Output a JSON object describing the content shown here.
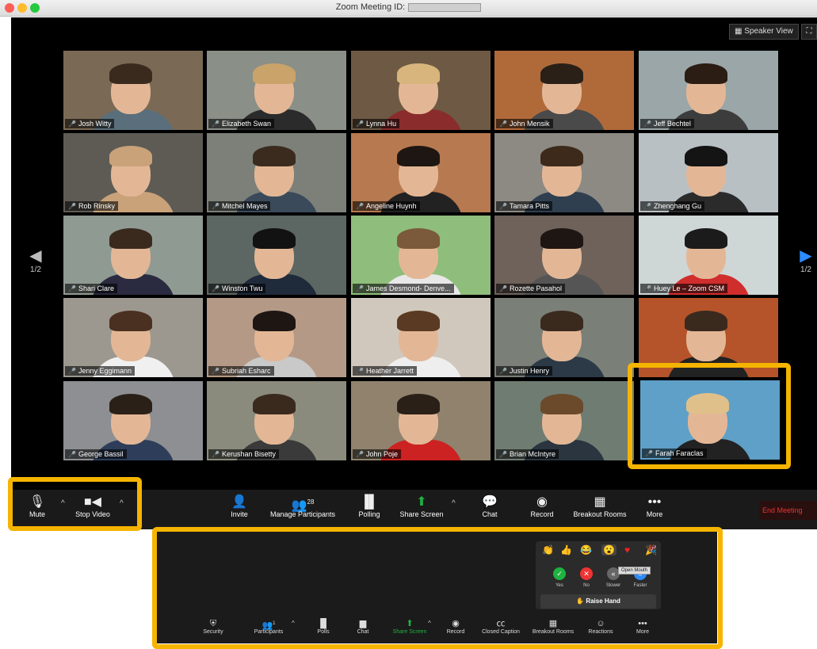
{
  "window": {
    "title": "Zoom Meeting ID:"
  },
  "top_buttons": {
    "speaker_view": "Speaker View",
    "fullscreen_icon": "fullscreen-icon"
  },
  "pagination": {
    "left": "1/2",
    "right": "1/2"
  },
  "participants": [
    {
      "name": "Josh Witty"
    },
    {
      "name": "Elizabeth Swan"
    },
    {
      "name": "Lynna Hu"
    },
    {
      "name": "John Mensik"
    },
    {
      "name": "Jeff Bechtel"
    },
    {
      "name": "Rob Rinsky"
    },
    {
      "name": "Mitchel Mayes"
    },
    {
      "name": "Angeline Huynh"
    },
    {
      "name": "Tamara Pitts"
    },
    {
      "name": "Zhenghang Gu"
    },
    {
      "name": "Shari Clare"
    },
    {
      "name": "Winston Twu"
    },
    {
      "name": "James Desmond- Denve..."
    },
    {
      "name": "Rozette Pasahol"
    },
    {
      "name": "Huey Le – Zoom CSM"
    },
    {
      "name": "Jenny Eggimann"
    },
    {
      "name": "Subriah Esharc"
    },
    {
      "name": "Heather Jarrett"
    },
    {
      "name": "Justin Henry"
    },
    {
      "name": ""
    },
    {
      "name": "George Bassil"
    },
    {
      "name": "Kerushan Bisetty"
    },
    {
      "name": "John Poje"
    },
    {
      "name": "Brian McIntyre"
    },
    {
      "name": "Farah Faraclas"
    }
  ],
  "toolbar": {
    "mute": "Mute",
    "stop_video": "Stop Video",
    "invite": "Invite",
    "manage_participants": "Manage Participants",
    "participant_count": "28",
    "polling": "Polling",
    "share_screen": "Share Screen",
    "chat": "Chat",
    "record": "Record",
    "breakout_rooms": "Breakout Rooms",
    "more": "More",
    "end_meeting": "End Meeting"
  },
  "toolbar2": {
    "security": "Security",
    "participants": "Participants",
    "participant_count": "1",
    "polls": "Polls",
    "chat": "Chat",
    "share_screen": "Share Screen",
    "record": "Record",
    "closed_caption": "Closed Caption",
    "breakout_rooms": "Breakout Rooms",
    "reactions": "Reactions",
    "more": "More"
  },
  "reactions": {
    "tooltip": "Open Mouth",
    "yes": "Yes",
    "no": "No",
    "slower": "Slower",
    "faster": "Faster",
    "raise_hand": "Raise Hand"
  },
  "colors": {
    "highlight": "#f5b400",
    "end_meeting": "#e33333",
    "share_green": "#1fb141"
  }
}
